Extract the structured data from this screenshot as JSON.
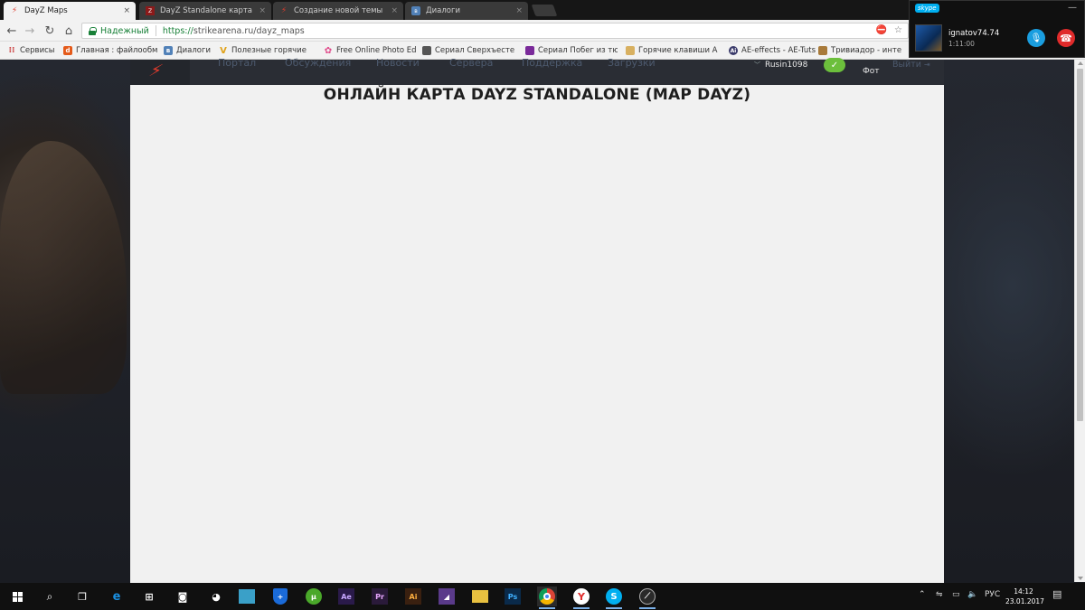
{
  "browser": {
    "tabs": [
      {
        "title": "DayZ Maps",
        "active": true,
        "icon": "lightning-icon",
        "color": "#e03b2c"
      },
      {
        "title": "DayZ Standalone карта",
        "active": false,
        "icon": "dayz-icon",
        "color": "#8b1a1a"
      },
      {
        "title": "Создание новой темы",
        "active": false,
        "icon": "lightning-icon",
        "color": "#e03b2c"
      },
      {
        "title": "Диалоги",
        "active": false,
        "icon": "vk-icon",
        "color": "#5181b8"
      }
    ],
    "tab_close": "×",
    "address": {
      "security_label": "Надежный",
      "url_protocol": "https://",
      "url_host": "strikearena.ru",
      "url_path": "/dayz_maps"
    },
    "bookmarks": [
      {
        "label": "Сервисы",
        "icon": "apps-icon",
        "color": "#c44"
      },
      {
        "label": "Главная : файлообм",
        "icon": "d-icon",
        "color": "#e45a1a"
      },
      {
        "label": "Диалоги",
        "icon": "vk-icon",
        "color": "#5181b8"
      },
      {
        "label": "Полезные горячие",
        "icon": "v-icon",
        "color": "#e0a21a"
      },
      {
        "label": "Free Online Photo Ed",
        "icon": "flower-icon",
        "color": "#e04a8a"
      },
      {
        "label": "Сериал Сверхъесте",
        "icon": "series-icon",
        "color": "#555"
      },
      {
        "label": "Сериал Побег из тю",
        "icon": "series-icon",
        "color": "#7a2a9a"
      },
      {
        "label": "Горячие клавиши А",
        "icon": "doc-icon",
        "color": "#d8b060"
      },
      {
        "label": "AE-effects - AE-Tuts",
        "icon": "ae-icon",
        "color": "#3a3a6a"
      },
      {
        "label": "Тривиадор - инте",
        "icon": "game-icon",
        "color": "#a87a3a"
      }
    ]
  },
  "site": {
    "nav": [
      "Портал",
      "Обсуждения",
      "Новости",
      "Сервера",
      "Поддержка",
      "Загрузки"
    ],
    "username": "Rusin1098",
    "check": "✓",
    "foto": "Фот",
    "logout": "Выйти",
    "page_title": "ОНЛАЙН КАРТА DAYZ STANDALONE (MAP DAYZ)"
  },
  "skype": {
    "brand": "skype",
    "contact": "ignatov74.74",
    "duration": "1:11:00"
  },
  "taskbar": {
    "language": "РУС",
    "time": "14:12",
    "date": "23.01.2017"
  }
}
